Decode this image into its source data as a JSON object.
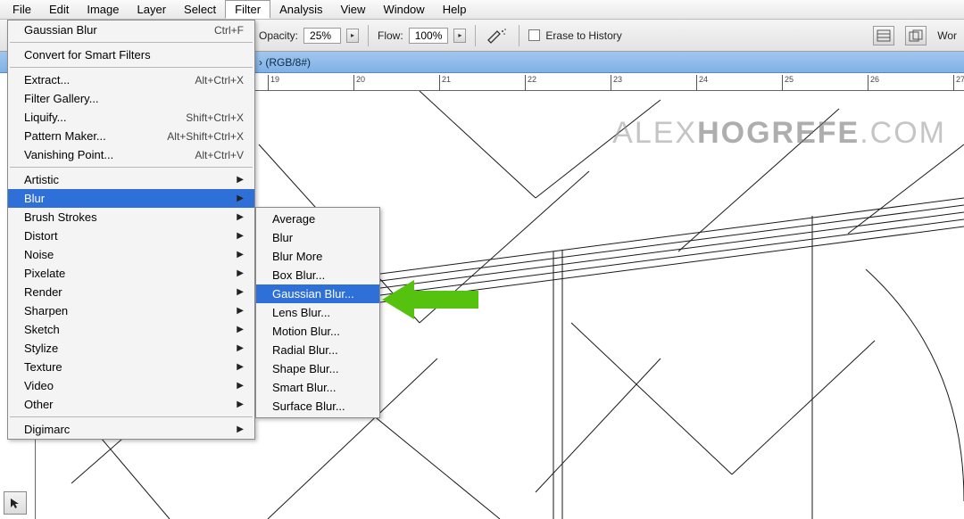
{
  "menubar": {
    "items": [
      "File",
      "Edit",
      "Image",
      "Layer",
      "Select",
      "Filter",
      "Analysis",
      "View",
      "Window",
      "Help"
    ],
    "active_index": 5
  },
  "options": {
    "opacity_label": "Opacity:",
    "opacity_value": "25%",
    "flow_label": "Flow:",
    "flow_value": "100%",
    "erase_label": "Erase to History",
    "right_label": "Wor"
  },
  "tab": {
    "title": "› (RGB/8#)"
  },
  "ruler": {
    "marks": [
      "19",
      "20",
      "21",
      "22",
      "23",
      "24",
      "25",
      "26",
      "27"
    ]
  },
  "watermark": {
    "a": "ALEX",
    "b": "HOGREFE",
    "c": ".COM"
  },
  "filter_menu": {
    "recent": {
      "label": "Gaussian Blur",
      "shortcut": "Ctrl+F"
    },
    "convert": "Convert for Smart Filters",
    "group1": [
      {
        "label": "Extract...",
        "shortcut": "Alt+Ctrl+X"
      },
      {
        "label": "Filter Gallery...",
        "shortcut": ""
      },
      {
        "label": "Liquify...",
        "shortcut": "Shift+Ctrl+X"
      },
      {
        "label": "Pattern Maker...",
        "shortcut": "Alt+Shift+Ctrl+X"
      },
      {
        "label": "Vanishing Point...",
        "shortcut": "Alt+Ctrl+V"
      }
    ],
    "group2": [
      "Artistic",
      "Blur",
      "Brush Strokes",
      "Distort",
      "Noise",
      "Pixelate",
      "Render",
      "Sharpen",
      "Sketch",
      "Stylize",
      "Texture",
      "Video",
      "Other"
    ],
    "group2_highlight_index": 1,
    "group3": [
      "Digimarc"
    ]
  },
  "blur_submenu": {
    "items": [
      "Average",
      "Blur",
      "Blur More",
      "Box Blur...",
      "Gaussian Blur...",
      "Lens Blur...",
      "Motion Blur...",
      "Radial Blur...",
      "Shape Blur...",
      "Smart Blur...",
      "Surface Blur..."
    ],
    "highlight_index": 4
  }
}
